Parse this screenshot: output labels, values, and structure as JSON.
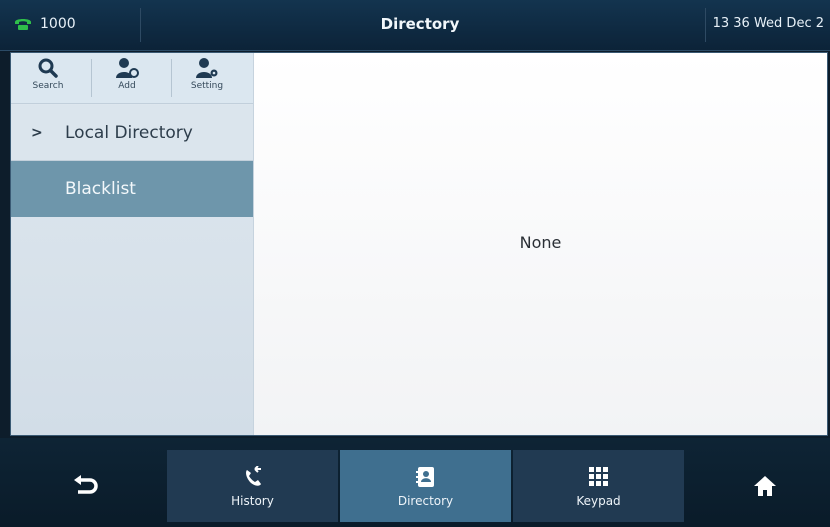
{
  "status_bar": {
    "line_label": "1000",
    "title": "Directory",
    "datetime": "13 36 Wed Dec 2"
  },
  "toolbar": {
    "search_label": "Search",
    "add_label": "Add",
    "setting_label": "Setting"
  },
  "sidebar": {
    "items": [
      {
        "label": "Local Directory",
        "chevron": ">",
        "selected": false
      },
      {
        "label": "Blacklist",
        "selected": true
      }
    ]
  },
  "main": {
    "empty_text": "None"
  },
  "bottom_nav": {
    "history_label": "History",
    "directory_label": "Directory",
    "keypad_label": "Keypad",
    "active_tab": "Directory"
  },
  "colors": {
    "phone_icon": "#2fbf4a",
    "selected_item": "#6e96ab",
    "active_tab": "#3f6f8f"
  }
}
